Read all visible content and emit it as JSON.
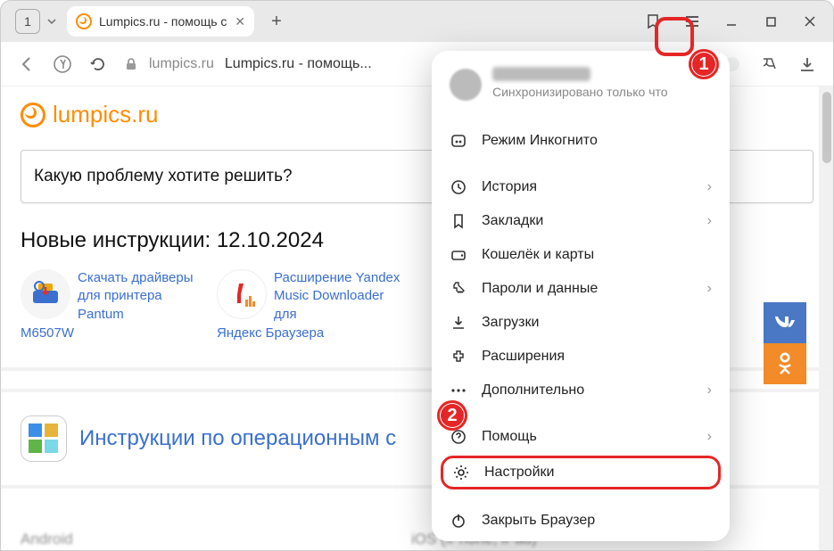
{
  "window": {
    "tab_count": "1",
    "tab_title": "Lumpics.ru - помощь с",
    "new_tab": "+"
  },
  "addr": {
    "host": "lumpics.ru",
    "title": "Lumpics.ru - помощь..."
  },
  "page": {
    "logo": "lumpics.ru",
    "search_placeholder": "Какую проблему хотите решить?",
    "new_instr_label": "Новые инструкции:",
    "new_instr_date": "12.10.2024",
    "card1_text": "Скачать драйверы для принтера Pantum",
    "card1_extra": "M6507W",
    "card2_text": "Расширение Yandex Music Downloader для",
    "card2_extra": "Яндекс Браузера",
    "os_title": "Инструкции по операционным с",
    "footer1": "Android",
    "footer2": "iOS (iPhone, iPad)"
  },
  "menu": {
    "sync": "Синхронизировано только что",
    "incognito": "Режим Инкогнито",
    "history": "История",
    "bookmarks": "Закладки",
    "wallet": "Кошелёк и карты",
    "passwords": "Пароли и данные",
    "downloads": "Загрузки",
    "extensions": "Расширения",
    "more": "Дополнительно",
    "help": "Помощь",
    "settings": "Настройки",
    "close": "Закрыть Браузер"
  },
  "badges": {
    "one": "1",
    "two": "2"
  }
}
